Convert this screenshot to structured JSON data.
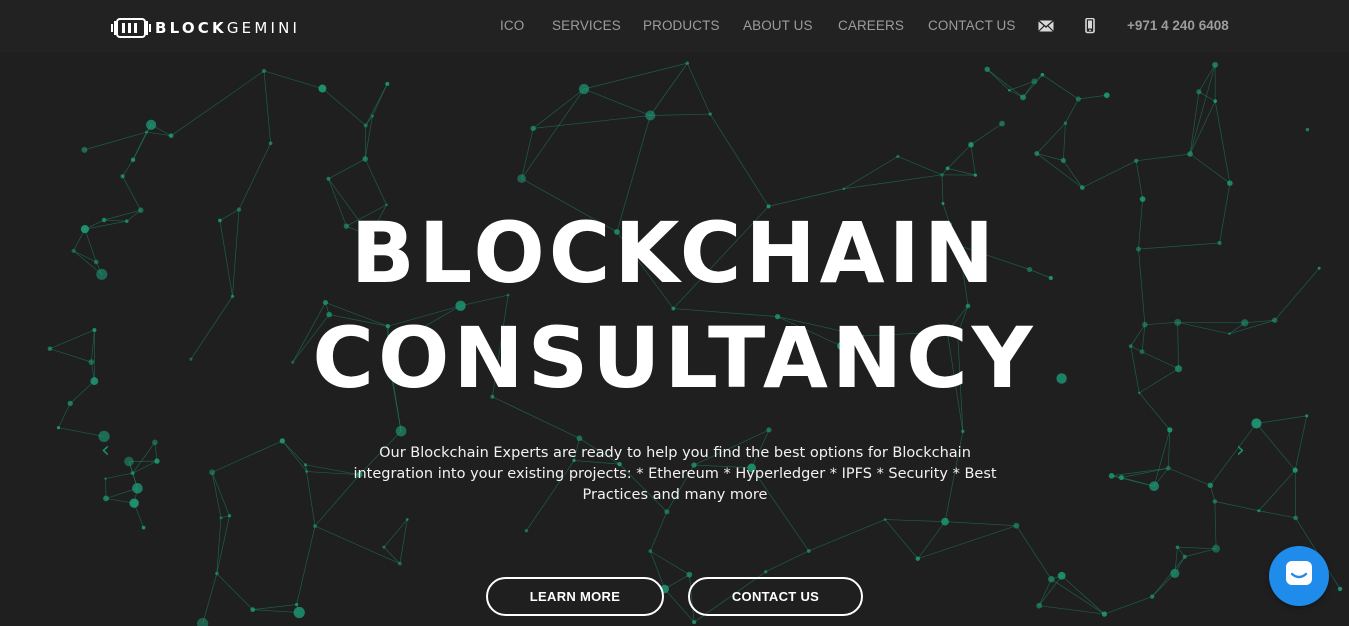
{
  "brand": {
    "logo_icon": "blockchain-blocks-icon",
    "name_bold": "BLOCK",
    "name_light": "GEMINI"
  },
  "nav": {
    "items": [
      {
        "label": "ICO"
      },
      {
        "label": "SERVICES"
      },
      {
        "label": "PRODUCTS"
      },
      {
        "label": "ABOUT US"
      },
      {
        "label": "CAREERS"
      },
      {
        "label": "CONTACT US"
      }
    ],
    "email_icon": "envelope-icon",
    "phone_icon": "mobile-phone-icon",
    "phone": "+971 4 240 6408"
  },
  "hero": {
    "title_line1": "BLOCKCHAIN",
    "title_line2": "CONSULTANCY",
    "subtitle": "Our Blockchain Experts are ready to help you find the best options for Blockchain integration into your existing projects: * Ethereum * Hyperledger * IPFS * Security * Best Practices and many more",
    "learn_more_label": "LEARN MORE",
    "contact_label": "CONTACT US",
    "prev_arrow": "‹",
    "next_arrow": "›"
  },
  "chat": {
    "icon": "chat-bubble-icon",
    "color": "#1f8ceb"
  },
  "colors": {
    "background": "#1f1f1f",
    "topbar": "#222222",
    "network_accent": "#1b8f6f",
    "nav_text": "#9c9c9c"
  }
}
